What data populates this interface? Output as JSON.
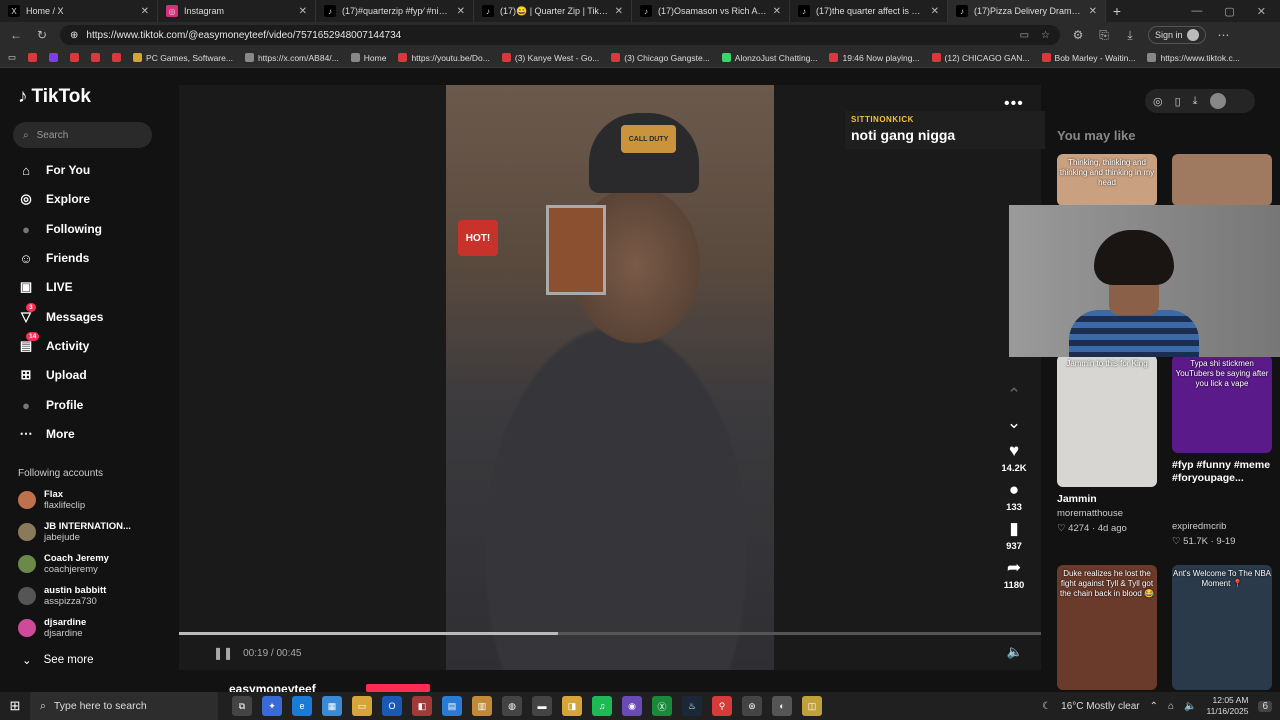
{
  "browser": {
    "tabs": [
      {
        "title": "Home / X",
        "icon": "x"
      },
      {
        "title": "Instagram",
        "icon": "ig"
      },
      {
        "title": "(17)#quarterzip #fyp⁄ #niketech",
        "icon": "tt"
      },
      {
        "title": "(17)😀 | Quarter Zip | TikTok",
        "icon": "tt"
      },
      {
        "title": "(17)Osamason vs Rich Amiri: Una",
        "icon": "tt"
      },
      {
        "title": "(17)the quarter affect is quite ple",
        "icon": "tt"
      },
      {
        "title": "(17)Pizza Delivery Drama: W",
        "icon": "tt"
      }
    ],
    "url": "https://www.tiktok.com/@easymoneyteef/video/7571652948007144734",
    "signin": "Sign in",
    "bookmarks": [
      {
        "label": "",
        "color": "#d63a3a"
      },
      {
        "label": "",
        "color": "#7b3fe4"
      },
      {
        "label": "",
        "color": "#d63a3a"
      },
      {
        "label": "",
        "color": "#d63a3a"
      },
      {
        "label": "",
        "color": "#d63a3a"
      },
      {
        "label": "PC Games, Software...",
        "color": "#d6a53a"
      },
      {
        "label": "https://x.com/AB84/...",
        "color": "#888"
      },
      {
        "label": "Home",
        "color": "#888"
      },
      {
        "label": "https://youtu.be/Do...",
        "color": "#d63a3a"
      },
      {
        "label": "(3) Kanye West - Go...",
        "color": "#d63a3a"
      },
      {
        "label": "(3) Chicago Gangste...",
        "color": "#d63a3a"
      },
      {
        "label": "AlonzoJust Chatting...",
        "color": "#3ad66a"
      },
      {
        "label": "19:46 Now playing...",
        "color": "#d63a3a"
      },
      {
        "label": "(12) CHICAGO GAN...",
        "color": "#d63a3a"
      },
      {
        "label": "Bob Marley - Waitin...",
        "color": "#d63a3a"
      },
      {
        "label": "https://www.tiktok.c...",
        "color": "#888"
      }
    ]
  },
  "sidebar": {
    "logo": "TikTok",
    "search_placeholder": "Search",
    "nav": [
      {
        "label": "For You",
        "icon": "⌂",
        "badge": ""
      },
      {
        "label": "Explore",
        "icon": "◎",
        "badge": ""
      },
      {
        "label": "Following",
        "icon": "●",
        "badge": ""
      },
      {
        "label": "Friends",
        "icon": "☺",
        "badge": ""
      },
      {
        "label": "LIVE",
        "icon": "▣",
        "badge": ""
      },
      {
        "label": "Messages",
        "icon": "▽",
        "badge": "3"
      },
      {
        "label": "Activity",
        "icon": "▤",
        "badge": "14"
      },
      {
        "label": "Upload",
        "icon": "⊞",
        "badge": ""
      },
      {
        "label": "Profile",
        "icon": "●",
        "badge": ""
      },
      {
        "label": "More",
        "icon": "⋯",
        "badge": ""
      }
    ],
    "following_header": "Following accounts",
    "accounts": [
      {
        "name": "Flax",
        "handle": "flaxlifeclip",
        "color": "#c0704a"
      },
      {
        "name": "JB INTERNATION...",
        "handle": "jabejude",
        "color": "#8a7a5a"
      },
      {
        "name": "Coach Jeremy",
        "handle": "coachjeremy",
        "color": "#6a8a4a"
      },
      {
        "name": "austin babbitt",
        "handle": "asspizza730",
        "color": "#555"
      },
      {
        "name": "djsardine",
        "handle": "djsardine",
        "color": "#d04a9a"
      }
    ],
    "see_more": "See more"
  },
  "player": {
    "time": "00:19 / 00:45",
    "progress": 0.44,
    "cap_text": "CALL DUTY",
    "hot_sign": "HOT!",
    "likes": "14.2K",
    "comments": "133",
    "saves": "937",
    "shares": "1180",
    "comment_user": "SITTINONKICK",
    "comment_text": "noti gang nigga",
    "author": "easymoneyteef"
  },
  "right": {
    "header": "You may like",
    "items": [
      {
        "overlay": "Thinking, thinking and thinking and thinking in my head",
        "title": "",
        "user": "",
        "meta": "",
        "color": "#c9a080"
      },
      {
        "overlay": "",
        "title": "",
        "user": "",
        "meta": "",
        "color": "#a07a60"
      },
      {
        "overlay": "Jammin to this for King",
        "title": "Jammin",
        "user": "morematthouse",
        "meta": "♡ 4274 · 4d ago",
        "color": "#d8d6d2"
      },
      {
        "overlay": "Typa shi stickmen YouTubers be saying after you lick a vape",
        "title": "#fyp #funny #meme #foryoupage...",
        "user": "expiredmcrib",
        "meta": "♡ 51.7K · 9-19",
        "color": "#5a1a8a"
      },
      {
        "overlay": "Duke realizes he lost the fight against Tyll & Tyll got the chain back in blood 😂",
        "title": "",
        "user": "",
        "meta": "",
        "color": "#6a3a2a"
      },
      {
        "overlay": "Ant's Welcome To The NBA Moment 📍",
        "title": "",
        "user": "",
        "meta": "",
        "color": "#2a3a4a"
      }
    ]
  },
  "taskbar": {
    "search": "Type here to search",
    "weather": "16°C  Mostly clear",
    "time": "12:05 AM",
    "date": "11/16/2025",
    "notifications": "6"
  }
}
